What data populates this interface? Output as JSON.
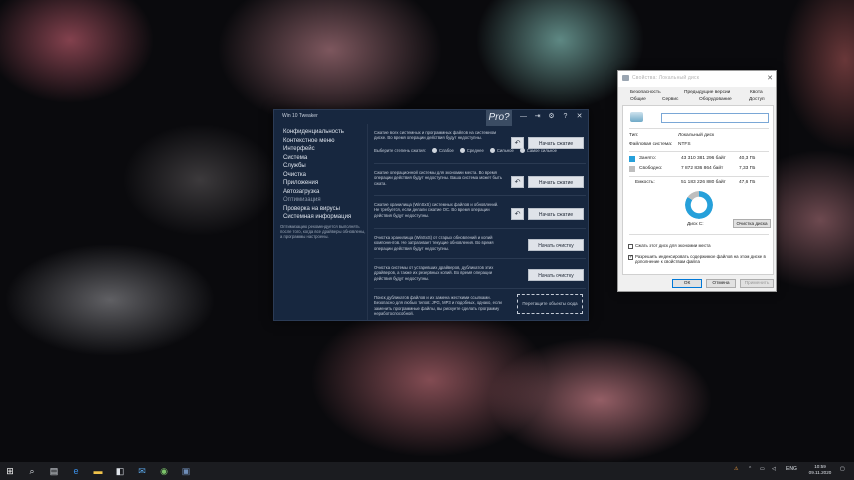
{
  "tweaker": {
    "title": "Win 10 Tweaker",
    "pro_badge": "Pro?",
    "controls": [
      "—",
      "⇥",
      "⚙",
      "?",
      "✕"
    ],
    "nav": [
      {
        "label": "Конфиденциальность",
        "muted": false
      },
      {
        "label": "Контекстное меню",
        "muted": false
      },
      {
        "label": "Интерфейс",
        "muted": false
      },
      {
        "label": "Система",
        "muted": false
      },
      {
        "label": "Службы",
        "muted": false
      },
      {
        "label": "Очистка",
        "muted": false
      },
      {
        "label": "Приложения",
        "muted": false
      },
      {
        "label": "Автозагрузка",
        "muted": false
      },
      {
        "label": "Оптимизация",
        "muted": true
      },
      {
        "label": "Проверка на вирусы",
        "muted": false
      },
      {
        "label": "Системная информация",
        "muted": false
      }
    ],
    "sidebar_note": "Оптимизацию рекомендуется выполнять после того, когда все драйверы обновлены, а программы настроены.",
    "rows": {
      "r0_text": "Сжатие всех системных и программных файлов на системном диске. Во время операции действия будут недоступны.",
      "r0_radio_label": "Выберите степень сжатия:",
      "r0_radios": [
        "Слабое",
        "Среднее",
        "Сильное",
        "Самое сильное"
      ],
      "r0_button": "Начать сжатие",
      "r1_text": "Сжатие операционной системы для экономии места. Во время операции действия будут недоступны. Ваша система может быть сжата.",
      "r1_button": "Начать сжатие",
      "r2_text": "Сжатие хранилища (WinSxS) системных файлов и обновлений. Не требуется, если делали сжатие ОС. Во время операции действия будут недоступны.",
      "r2_button": "Начать сжатие",
      "r3_text": "Очистка хранилища (WinSxS) от старых обновлений и копий компонентов. Не затрагивает текущие обновления. Во время операции действия будут недоступны.",
      "r3_button": "Начать очистку",
      "r4_text": "Очистка системы от устаревших драйверов, дубликатов этих драйверов, а также их резервных копий. Во время операции действия будут недоступны.",
      "r4_button": "Начать очистку",
      "r5_text": "Поиск дубликатов файлов и их замена жесткими ссылками. Безопасно для любых типов: JPG, MP3 и подобных, однако, если заменить программные файлы, вы рискуете сделать программу неработоспособной.",
      "r5_drop": "Перетащите объекты сюда"
    }
  },
  "props": {
    "title": "Свойства: Локальный диск",
    "tabs_top": [
      "Безопасность",
      "Предыдущие версии",
      "Квота"
    ],
    "tabs_bottom": [
      "Общие",
      "Сервис",
      "Оборудование",
      "Доступ"
    ],
    "type_label": "Тип:",
    "type_value": "Локальный диск",
    "fs_label": "Файловая система:",
    "fs_value": "NTFS",
    "used_label": "Занято:",
    "used_bytes": "43 310 381 296 байт",
    "used_gb": "40,3 ГБ",
    "free_label": "Свободно:",
    "free_bytes": "7 872 836 864 байт",
    "free_gb": "7,33 ГБ",
    "capacity_label": "Емкость:",
    "capacity_bytes": "51 183 226 880 байт",
    "capacity_gb": "47,6 ГБ",
    "disk_label": "Диск C:",
    "cleanup_button": "Очистка диска",
    "used_fraction": 0.846,
    "check1": "Сжать этот диск для экономии места",
    "check2": "Разрешить индексировать содержимое файлов на этом диске в дополнение к свойствам файла",
    "ok": "ОК",
    "cancel": "Отмена",
    "apply": "Применить",
    "colors": {
      "used": "#26a0da",
      "free": "#bebebe"
    }
  },
  "taskbar": {
    "icons": [
      "windows-start-icon",
      "search-icon",
      "task-view-icon",
      "file-explorer-icon",
      "store-icon",
      "mail-icon",
      "edge-icon",
      "chrome-icon",
      "app-icon"
    ],
    "lang": "ENG",
    "time": "10:59",
    "date": "09.11.2020"
  }
}
